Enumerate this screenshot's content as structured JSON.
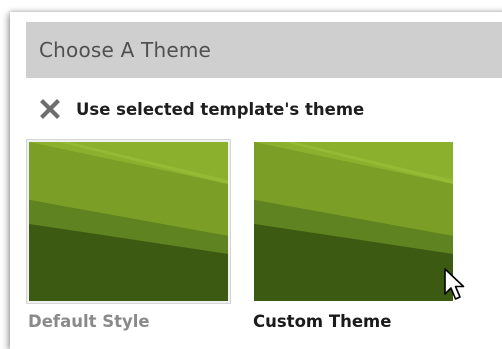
{
  "header": {
    "title": "Choose A Theme"
  },
  "option": {
    "icon": "close-x-icon",
    "label": "Use selected template's theme"
  },
  "themes": [
    {
      "label": "Default Style",
      "state": "normal"
    },
    {
      "label": "Custom Theme",
      "state": "hovered"
    }
  ],
  "colors": {
    "header_bg": "#cfcfcf",
    "header_text": "#505050",
    "thumb_light": "#86a92c",
    "thumb_mid": "#6b8f22",
    "thumb_dark": "#3d5a12",
    "label_muted": "#8a8a8a",
    "label_active": "#1a1a1a"
  },
  "cursor": {
    "icon": "mouse-pointer-icon"
  }
}
